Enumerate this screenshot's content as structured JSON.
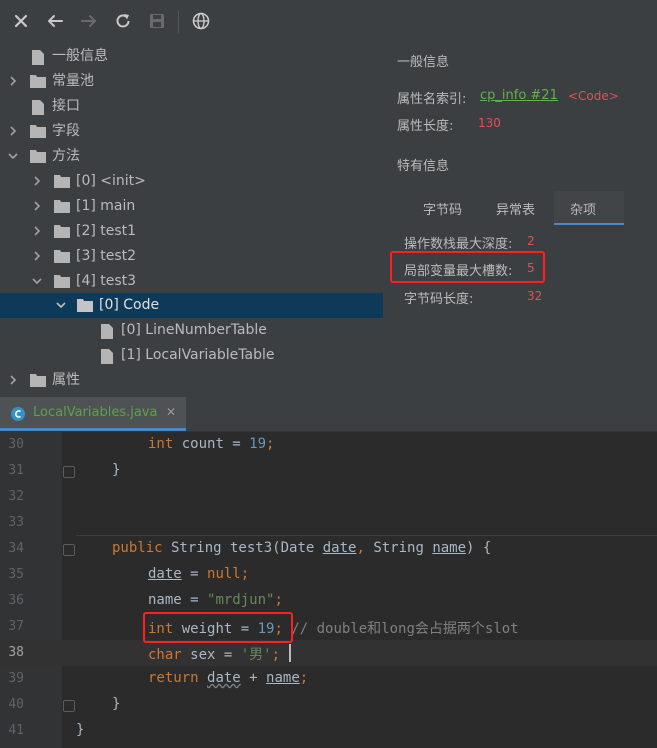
{
  "toolbar": {
    "buttons": [
      {
        "name": "close-icon",
        "glyph": "✕"
      },
      {
        "name": "back-arrow-icon",
        "glyph": "←"
      },
      {
        "name": "forward-arrow-icon",
        "glyph": "→"
      },
      {
        "name": "refresh-icon",
        "glyph": "↻"
      },
      {
        "name": "save-icon",
        "glyph": "💾"
      },
      {
        "name": "globe-icon",
        "glyph": "🌐"
      }
    ]
  },
  "tree": {
    "items": [
      {
        "label": "一般信息",
        "expanded": null
      },
      {
        "label": "常量池",
        "expanded": false
      },
      {
        "label": "接口",
        "expanded": null
      },
      {
        "label": "字段",
        "expanded": false
      },
      {
        "label": "方法",
        "expanded": true
      },
      {
        "label": "[0] <init>",
        "expanded": false
      },
      {
        "label": "[1] main",
        "expanded": false
      },
      {
        "label": "[2] test1",
        "expanded": false
      },
      {
        "label": "[3] test2",
        "expanded": false
      },
      {
        "label": "[4] test3",
        "expanded": true
      },
      {
        "label": "[0] Code",
        "expanded": true,
        "selected": true
      },
      {
        "label": "[0] LineNumberTable",
        "expanded": null
      },
      {
        "label": "[1] LocalVariableTable",
        "expanded": null
      },
      {
        "label": "属性",
        "expanded": false
      }
    ]
  },
  "info": {
    "general_title": "一般信息",
    "attr_name_label": "属性名索引:",
    "attr_name_link": "cp_info #21",
    "attr_name_value": "<Code>",
    "attr_len_label": "属性长度:",
    "attr_len_value": "130",
    "specific_title": "特有信息",
    "tabs": [
      "字节码",
      "异常表",
      "杂项"
    ],
    "active_tab": "杂项",
    "rows": [
      {
        "label": "操作数栈最大深度:",
        "value": "2"
      },
      {
        "label": "局部变量最大槽数:",
        "value": "5"
      },
      {
        "label": "字节码长度:",
        "value": "32"
      }
    ]
  },
  "editor_tab": {
    "filename": "LocalVariables.java",
    "close": "✕"
  },
  "editor": {
    "line_numbers": [
      "30",
      "31",
      "32",
      "33",
      "34",
      "35",
      "36",
      "37",
      "38",
      "39",
      "40",
      "41"
    ],
    "current_line": "38"
  },
  "colors": {
    "accent": "#4a88c7",
    "highlight_box": "#ff1f1f",
    "keyword": "#cc7832",
    "number": "#6897bb",
    "string": "#6a8759"
  }
}
